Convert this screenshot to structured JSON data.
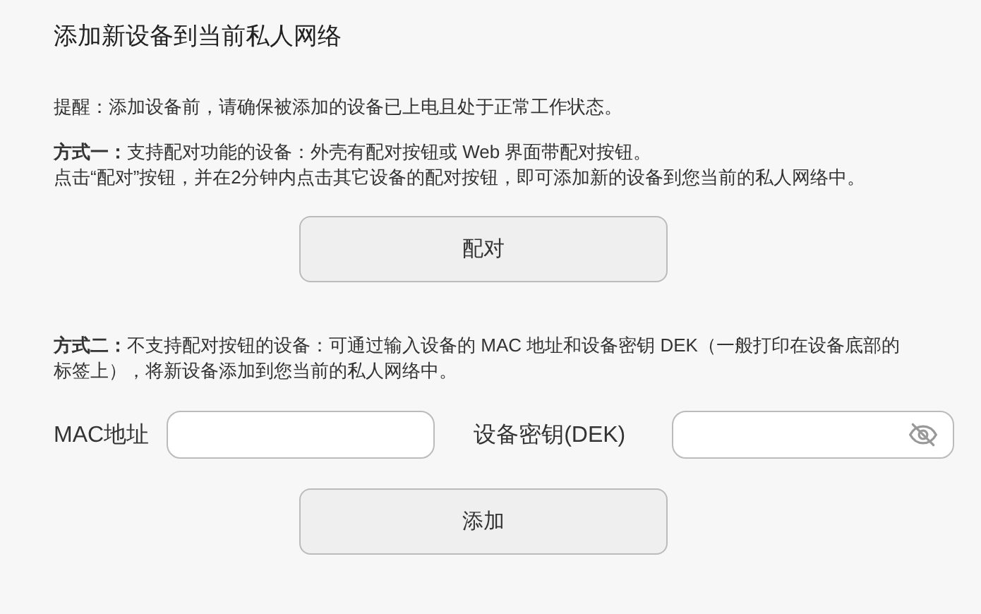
{
  "title": "添加新设备到当前私人网络",
  "hint": "提醒：添加设备前，请确保被添加的设备已上电且处于正常工作状态。",
  "method_one": {
    "heading": "**方式一：**支持配对功能的设备：外壳有配对按钮或 Web 界面带配对按钮。",
    "body": "点击“配对”按钮，并在2分钟内点击其它设备的配对按钮，即可添加新的设备到您当前的私人网络中。",
    "button": "配对"
  },
  "method_two": {
    "text": "**方式二：**不支持配对按钮的设备：可通过输入设备的 MAC 地址和设备密钥 DEK（一般打印在设备底部的标签上），将新设备添加到您当前的私人网络中。",
    "fields": [
      {
        "label": "MAC地址",
        "kind": "text"
      },
      {
        "label": "设备密钥(DEK)",
        "kind": "password"
      }
    ],
    "button": "添加"
  }
}
